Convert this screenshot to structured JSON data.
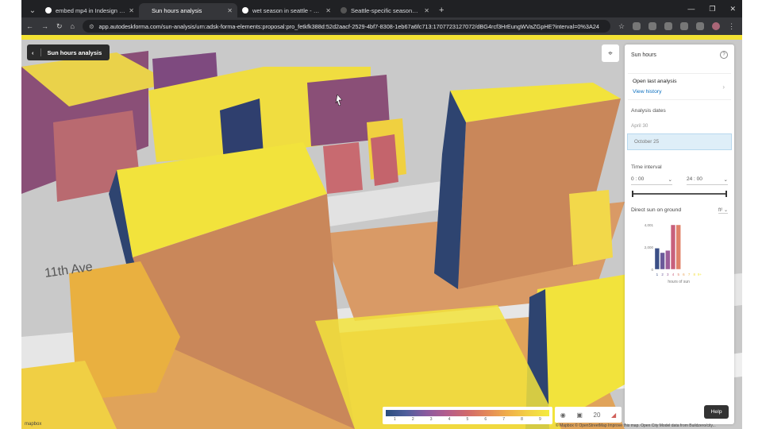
{
  "browser": {
    "tabs": [
      {
        "title": "embed mp4 in Indesign - Goog",
        "active": false
      },
      {
        "title": "Sun hours analysis",
        "active": true
      },
      {
        "title": "wet season in seattle - Google",
        "active": false
      },
      {
        "title": "Seattle-specific seasons and th",
        "active": false
      }
    ],
    "url": "app.autodeskforma.com/sun-analysis/urn:adsk-forma-elements:proposal:pro_fetkfk388d:52d2aacf-2529-4bf7-8308-1eb67a6fc713:1707723127072/dBG4rcf3HrEungWVaZGpHE?interval=0%3A24"
  },
  "viewport": {
    "back_label": "Sun hours analysis",
    "street_label": "11th Ave",
    "mapbox": "mapbox",
    "attribution": "© Mapbox © OpenStreetMap Improve this map. Open City Model data from Buildzero/city..."
  },
  "panel": {
    "title": "Sun hours",
    "open_last": "Open last analysis",
    "view_history": "View history",
    "analysis_dates_label": "Analysis dates",
    "dates": [
      "April 30",
      "October 25"
    ],
    "selected_date": "October 25",
    "time_interval_label": "Time interval",
    "start_time": "0 : 00",
    "end_time": "24 : 00",
    "direct_sun_label": "Direct sun on ground",
    "unit": "ft²"
  },
  "chart_data": {
    "type": "bar",
    "categories": [
      "1",
      "2",
      "3",
      "4",
      "5",
      "6",
      "7",
      "8",
      "9+"
    ],
    "values": [
      1900,
      1500,
      1700,
      4000,
      4000,
      0,
      0,
      0,
      0
    ],
    "colors": [
      "#3b4f86",
      "#6b5a9a",
      "#9b5e9a",
      "#c8607c",
      "#e0826a",
      "#e8a258",
      "#f0c04c",
      "#f2da44",
      "#f4ec3e"
    ],
    "yticks": [
      "4,001",
      "2,000",
      "0"
    ],
    "ylim": [
      0,
      4001
    ],
    "xlabel": "hours of sun"
  },
  "legend": {
    "ticks": [
      "1",
      "2",
      "3",
      "4",
      "5",
      "6",
      "7",
      "8",
      "9"
    ]
  },
  "tools": {
    "count": "20"
  },
  "help_label": "Help",
  "colors": {
    "accent_yellow": "#f3e234",
    "panel_selected": "#deeef8"
  }
}
